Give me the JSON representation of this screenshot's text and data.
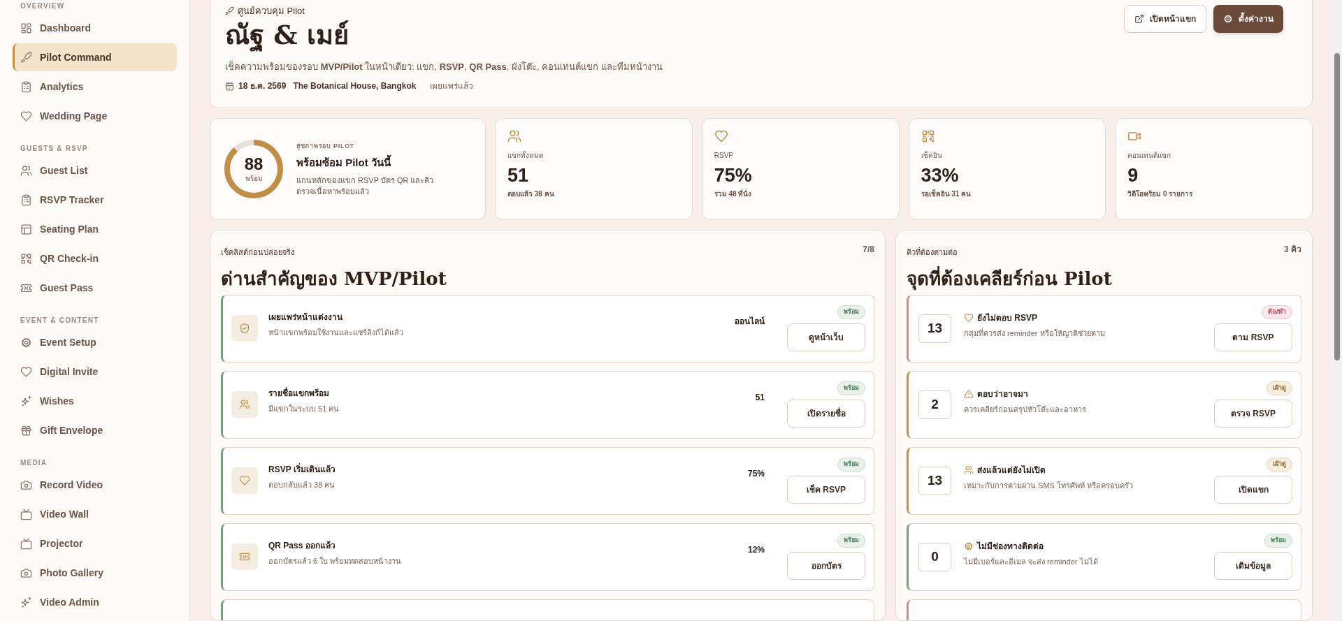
{
  "sidebar": {
    "groups": [
      {
        "label": "OVERVIEW",
        "items": [
          {
            "label": "Dashboard",
            "selected": false
          },
          {
            "label": "Pilot Command",
            "selected": true
          },
          {
            "label": "Analytics",
            "selected": false
          },
          {
            "label": "Wedding Page",
            "selected": false
          }
        ]
      },
      {
        "label": "GUESTS & RSVP",
        "items": [
          {
            "label": "Guest List",
            "selected": false
          },
          {
            "label": "RSVP Tracker",
            "selected": false
          },
          {
            "label": "Seating Plan",
            "selected": false
          },
          {
            "label": "QR Check-in",
            "selected": false
          },
          {
            "label": "Guest Pass",
            "selected": false
          }
        ]
      },
      {
        "label": "EVENT & CONTENT",
        "items": [
          {
            "label": "Event Setup",
            "selected": false
          },
          {
            "label": "Digital Invite",
            "selected": false
          },
          {
            "label": "Wishes",
            "selected": false
          },
          {
            "label": "Gift Envelope",
            "selected": false
          }
        ]
      },
      {
        "label": "MEDIA",
        "items": [
          {
            "label": "Record Video",
            "selected": false
          },
          {
            "label": "Video Wall",
            "selected": false
          },
          {
            "label": "Projector",
            "selected": false
          },
          {
            "label": "Photo Gallery",
            "selected": false
          },
          {
            "label": "Video Admin",
            "selected": false
          }
        ]
      }
    ]
  },
  "header": {
    "kicker": "ศูนย์ควบคุม Pilot",
    "title": "ณัฐ & เมย์",
    "description": "เช็คความพร้อมของรอบ **MVP/Pilot** ในหน้าเดียว: แขก, **RSVP**, **QR Pass**, ผังโต๊ะ, คอนเทนต์แขก และทีมหน้างาน",
    "date": "18 ธ.ค. 2569",
    "venue": "The Botanical House, Bangkok",
    "publish_status": "เผยแพร่แล้ว",
    "buttons": [
      "เปิดหน้าแขก",
      "ตั้งค่างาน"
    ]
  },
  "health": {
    "kicker": "สุขภาพรอบ PILOT",
    "title": "พร้อมซ้อม Pilot วันนี้",
    "text": "แกนหลักของแขก RSVP บัตร QR และคิวตรวจเนื้อหาพร้อมแล้ว",
    "value": "88",
    "value_label": "พร้อม",
    "level": 0.88
  },
  "stats": [
    {
      "label": "แขกทั้งหมด",
      "value": "51",
      "sub": "ตอบแล้ว 38 คน"
    },
    {
      "label": "RSVP",
      "value": "75%",
      "sub": "รวม 48 ที่นั่ง"
    },
    {
      "label": "เช็คอิน",
      "value": "33%",
      "sub": "รอเช็คอิน 31 คน"
    },
    {
      "label": "คอนเทนต์แขก",
      "value": "9",
      "sub": "วิดีโอพร้อม 0 รายการ"
    }
  ],
  "checklist": {
    "kicker": "เช็คลิสต์ก่อนปล่อยจริง",
    "count": "7/8",
    "title": "ด่านสำคัญของ MVP/Pilot",
    "items": [
      {
        "title": "เผยแพร่หน้าแต่งงาน",
        "desc": "หน้าแขกพร้อมใช้งานและแชร์ลิงก์ได้แล้ว",
        "value": "ออนไลน์",
        "badge": "พร้อม",
        "kind": "ready",
        "button": "ดูหน้าเว็บ"
      },
      {
        "title": "รายชื่อแขกพร้อม",
        "desc": "มีแขกในระบบ 51 คน",
        "value": "51",
        "badge": "พร้อม",
        "kind": "ready",
        "button": "เปิดรายชื่อ"
      },
      {
        "title": "RSVP เริ่มเดินแล้ว",
        "desc": "ตอบกลับแล้ว 38 คน",
        "value": "75%",
        "badge": "พร้อม",
        "kind": "ready",
        "button": "เช็ค RSVP"
      },
      {
        "title": "QR Pass ออกแล้ว",
        "desc": "ออกบัตรแล้ว 6 ใบ พร้อมทดสอบหน้างาน",
        "value": "12%",
        "badge": "พร้อม",
        "kind": "ready",
        "button": "ออกบัตร"
      }
    ]
  },
  "queue": {
    "kicker": "คิวที่ต้องตามต่อ",
    "count": "3 คิว",
    "title": "จุดที่ต้องเคลียร์ก่อน Pilot",
    "items": [
      {
        "number": "13",
        "title": "ยังไม่ตอบ RSVP",
        "desc": "กลุ่มที่ควรส่ง reminder หรือให้ญาติช่วยตาม",
        "badge": "ต้องทำ",
        "kind": "todo",
        "button": "ตาม RSVP"
      },
      {
        "number": "2",
        "title": "ตอบว่าอาจมา",
        "desc": "ควรเคลียร์ก่อนสรุปหัวโต๊ะและอาหาร",
        "badge": "เฝ้าดู",
        "kind": "watch",
        "button": "ตรวจ RSVP"
      },
      {
        "number": "13",
        "title": "ส่งแล้วแต่ยังไม่เปิด",
        "desc": "เหมาะกับการตามผ่าน SMS โทรศัพท์ หรือครอบครัว",
        "badge": "เฝ้าดู",
        "kind": "watch",
        "button": "เปิดแขก"
      },
      {
        "number": "0",
        "title": "ไม่มีช่องทางติดต่อ",
        "desc": "ไม่มีเบอร์และอีเมล จะส่ง reminder ไม่ได้",
        "badge": "พร้อม",
        "kind": "ready",
        "button": "เติมข้อมูล"
      }
    ]
  }
}
